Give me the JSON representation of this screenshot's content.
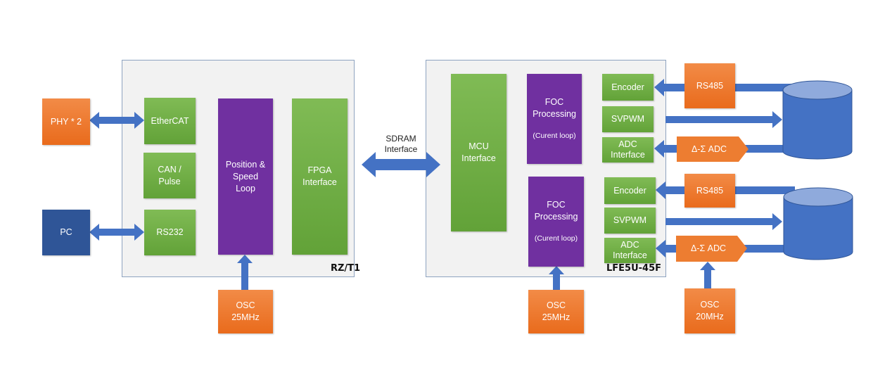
{
  "colors": {
    "arrow": "#4472c4",
    "green": "#70ad47",
    "orange": "#ed7d31",
    "purple": "#7030a0",
    "pc": "#2f5597",
    "chip_bg": "#f2f2f2"
  },
  "left_chip": {
    "label": "RZ/T1",
    "ethercat": "EtherCAT",
    "can": "CAN /\nPulse",
    "rs232": "RS232",
    "pos_speed": "Position &\nSpeed\nLoop",
    "fpga": "FPGA\nInterface"
  },
  "external_left": {
    "phy": "PHY * 2",
    "pc": "PC",
    "osc": "OSC\n25MHz"
  },
  "sdram": "SDRAM\nInterface",
  "right_chip": {
    "label": "LFE5U-45F",
    "mcu": "MCU\nInterface",
    "foc": [
      {
        "title": "FOC\nProcessing",
        "sub": "(Curent loop)"
      },
      {
        "title": "FOC\nProcessing",
        "sub": "(Curent loop)"
      }
    ],
    "channels": [
      {
        "encoder": "Encoder",
        "svpwm": "SVPWM",
        "adc": "ADC\nInterface"
      },
      {
        "encoder": "Encoder",
        "svpwm": "SVPWM",
        "adc": "ADC\nInterface"
      }
    ]
  },
  "external_right": {
    "rs485": [
      "RS485",
      "RS485"
    ],
    "dsadc": [
      "Δ-Σ ADC",
      "Δ-Σ ADC"
    ],
    "osc_foc": "OSC\n25MHz",
    "osc_adc": "OSC\n20MHz"
  }
}
